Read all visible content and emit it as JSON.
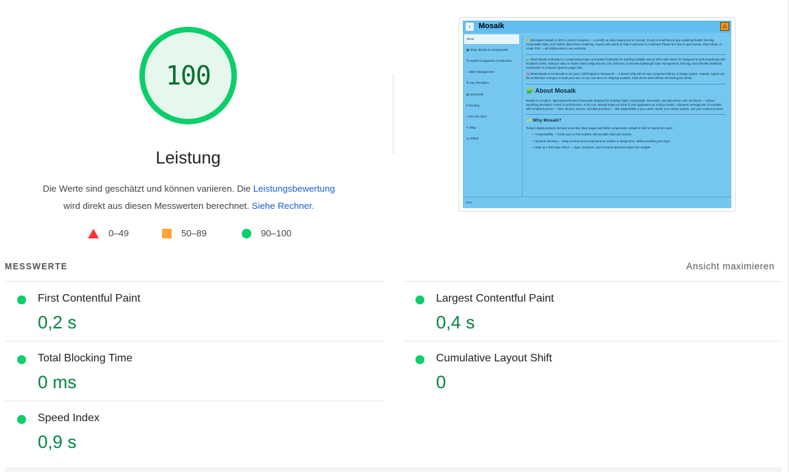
{
  "performance": {
    "score": "100",
    "score_fraction": 1.0,
    "title": "Leistung",
    "description_part1": "Die Werte sind geschätzt und können variieren. Die ",
    "description_link1": "Leistungsbewertung",
    "description_part2": "wird direkt aus diesen Messwerten berechnet. ",
    "description_link2": "Siehe Rechner.",
    "colors": {
      "pass": "#0cce6b",
      "average": "#ffa53a",
      "fail": "#ff3333",
      "pass_text": "#018642"
    }
  },
  "legend": [
    {
      "icon": "triangle-icon",
      "range": "0–49"
    },
    {
      "icon": "square-icon",
      "range": "50–89"
    },
    {
      "icon": "circle-icon",
      "range": "90–100"
    }
  ],
  "screenshot": {
    "app_title": "Mosaik",
    "back_glyph": "‹",
    "warn_glyph": "⚠",
    "sidebar": [
      {
        "icon": "",
        "label": "About"
      },
      {
        "icon": "▦",
        "label": "Slots, Blocks & Components"
      },
      {
        "icon": "☰",
        "label": "Hybrid Component Architecture"
      },
      {
        "icon": "◌",
        "label": "State Management"
      },
      {
        "icon": "❢",
        "label": "Key Principles"
      },
      {
        "icon": "▤",
        "label": "SSG/SSR"
      },
      {
        "icon": "⑈",
        "label": "Routing"
      },
      {
        "icon": "⌕",
        "label": "Run the docs"
      },
      {
        "icon": "✎",
        "label": "Blog"
      },
      {
        "icon": "◎",
        "label": "Github"
      }
    ],
    "disclaimer": "⚠️ Disclaimer Mosaik is 100% a work in progress — currently an early-stage proof of concept. It's just a small Next.js app exploring flexible theming, composable state, and modern data-driven rendering. Anyone who wants to help is welcome to contribute! Please feel free to open issues, share ideas, or create PRs — all collaboration is very welcome.",
    "what_is": "🧩 What Mosaik is Mosaik is a compositional layer and starter boilerplate for building scalable Next.js SPAs with React. It's designed to work seamlessly with headless CMSs, making it easy to render CMS-configured UIs. Out of the box, it provides lightweight state management, theming, and a flexible slot/block mechanism to compose dynamic pages fast.",
    "what_is_not": "🚫 What Mosaik is not Mosaik is not (yet) a full-fledged UI framework — it doesn't ship with its own component library or design system. Instead, it gives you the architecture and glue to build your own, so you can focus on shipping scalable, CMS-driven sites without reinventing the wheel.",
    "about_heading": "🧩 About Mosaik",
    "about_text": "Mosaik is a modern, opinionated frontend framework designed for building highly composable, themeable, and data-driven user interfaces — without sacrificing developer control or performance. At its core, Mosaik helps you think of your application as a living mosaic: a dynamic arrangement of reusable, self-contained pieces — slots, themes, actions, and data providers — that adapt fluidly to your users' needs, your design system, and your content sources.",
    "why_heading": "✨ Why Mosaik?",
    "why_text": "Today's digital products demand more than static pages and brittle components. Mosaik is built for teams who want:",
    "why_items": [
      "— Composability — break your UI into isolated, discoverable slots and actions.",
      "— Dynamic theming — swap out slots and components at runtime or design time, without rewriting your logic.",
      "— Data as a first-class citizen — inject, transform, and consume structured data from multiple"
    ],
    "footer": "2025"
  },
  "metrics": {
    "title": "MESSWERTE",
    "expand_label": "Ansicht maximieren",
    "items": [
      {
        "name": "first-contentful-paint",
        "label": "First Contentful Paint",
        "value": "0,2 s"
      },
      {
        "name": "largest-contentful-paint",
        "label": "Largest Contentful Paint",
        "value": "0,4 s"
      },
      {
        "name": "total-blocking-time",
        "label": "Total Blocking Time",
        "value": "0 ms"
      },
      {
        "name": "cumulative-layout-shift",
        "label": "Cumulative Layout Shift",
        "value": "0"
      },
      {
        "name": "speed-index",
        "label": "Speed Index",
        "value": "0,9 s"
      }
    ]
  }
}
